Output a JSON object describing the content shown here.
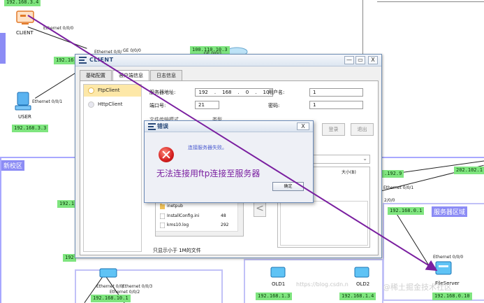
{
  "topology": {
    "ip_labels": {
      "top_left": "192.168.3.4",
      "client_segment": "192.16",
      "isp": "100.110.10.3",
      "user_ip": "192.168.3.3",
      "left_mid": "192.1",
      "left_low": "192",
      "srv_segment_a": ".192.9",
      "srv_segment_b": "202.102.1",
      "server_gw": "192.168.0.1",
      "server_ip": "192.168.0.10",
      "old1_ip": "192.168.1.3",
      "old2_ip": "192.168.1.4",
      "bottom_left": "192.168.10.1"
    },
    "port_labels": {
      "client_eth": "Ethernet 0/0/0",
      "router_eth": "Ethernet 0/0/",
      "router_ge": "GE 0/0/0",
      "isp_ge": "GE 0/0/1",
      "user_eth": "Ethernet 0/0/1",
      "right_eth1": "Ethernet 0/0/1",
      "right_eth2": "Ethernet 0/0/1",
      "right_2_0_0": "2/0/0",
      "fs_eth": "Ethernet 0/0/0",
      "bottom_eth03": "Ethernet 0/0/3",
      "bottom_eth0": "Ethernet 0/0/",
      "bottom_eth02": "Ethernet 0/0/2",
      "bottom_ethernet": "Ethernet"
    },
    "nodes": {
      "client": "CLIENT",
      "user": "USER",
      "old1": "OLD1",
      "old2": "OLD2",
      "fileserver": "FileServer"
    },
    "zones": {
      "new_campus": "新校区",
      "server_area": "服务器区域"
    }
  },
  "client_window": {
    "title": "CLIENT",
    "controls": {
      "minimize": "—",
      "maximize": "▭",
      "close": "X"
    },
    "tabs": [
      "基础配置",
      "客户端信息",
      "日志信息"
    ],
    "active_tab": 1,
    "side_items": [
      "FtpClient",
      "HttpClient"
    ],
    "form": {
      "server_addr_label": "服务器地址:",
      "server_ip": [
        "192",
        "168",
        "0",
        "10"
      ],
      "username_label": "用户名:",
      "username_value": "1",
      "port_label": "端口号:",
      "port_value": "21",
      "password_label": "密码:",
      "password_value": "1",
      "transfer_mode_label": "文件传输模式",
      "type_label": "类型",
      "login_button": "登录",
      "logout_button": "退出",
      "size_column": "大小(B)",
      "footer_note": "只显示小于 1M的文件"
    },
    "files": [
      {
        "name": "inetpub",
        "size": ""
      },
      {
        "name": "InstallConfig.ini",
        "size": "48"
      },
      {
        "name": "kms10.log",
        "size": "292"
      }
    ]
  },
  "error_dialog": {
    "title": "错误",
    "message": "连接服务器失败。",
    "ok_button": "确定",
    "close_button": "X"
  },
  "annotation": "无法连接用ftp连接至服务器",
  "watermarks": {
    "left": "https://blog.csdn.n",
    "right": "@稀土掘金技术社区"
  },
  "colors": {
    "ip_label_bg": "#7fe57f",
    "zone_border": "#a8a8ff",
    "arrow": "#7a1fa0",
    "error_text": "#4b5bd0",
    "selected_item": "#fde8a8"
  }
}
